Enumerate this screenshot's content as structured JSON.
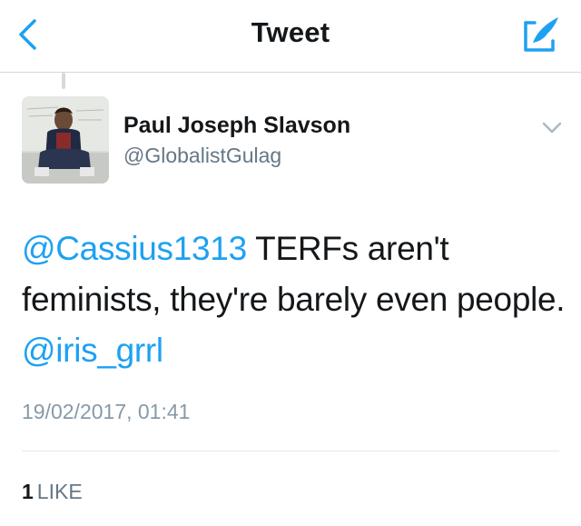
{
  "header": {
    "title": "Tweet",
    "back_icon": "chevron-left-icon",
    "compose_icon": "compose-tweet-icon",
    "accent_color": "#1da1f2"
  },
  "tweet": {
    "author": {
      "name": "Paul Joseph Slavson",
      "handle": "@GlobalistGulag",
      "avatar_icon": "avatar"
    },
    "text": {
      "mention_1": "@Cassius1313",
      "body": " TERFs aren't feminists, they're barely even people. ",
      "mention_2": "@iris_grrl"
    },
    "timestamp": "19/02/2017, 01:41",
    "likes": {
      "count": "1",
      "label": "LIKE"
    },
    "menu_icon": "chevron-down-icon"
  }
}
